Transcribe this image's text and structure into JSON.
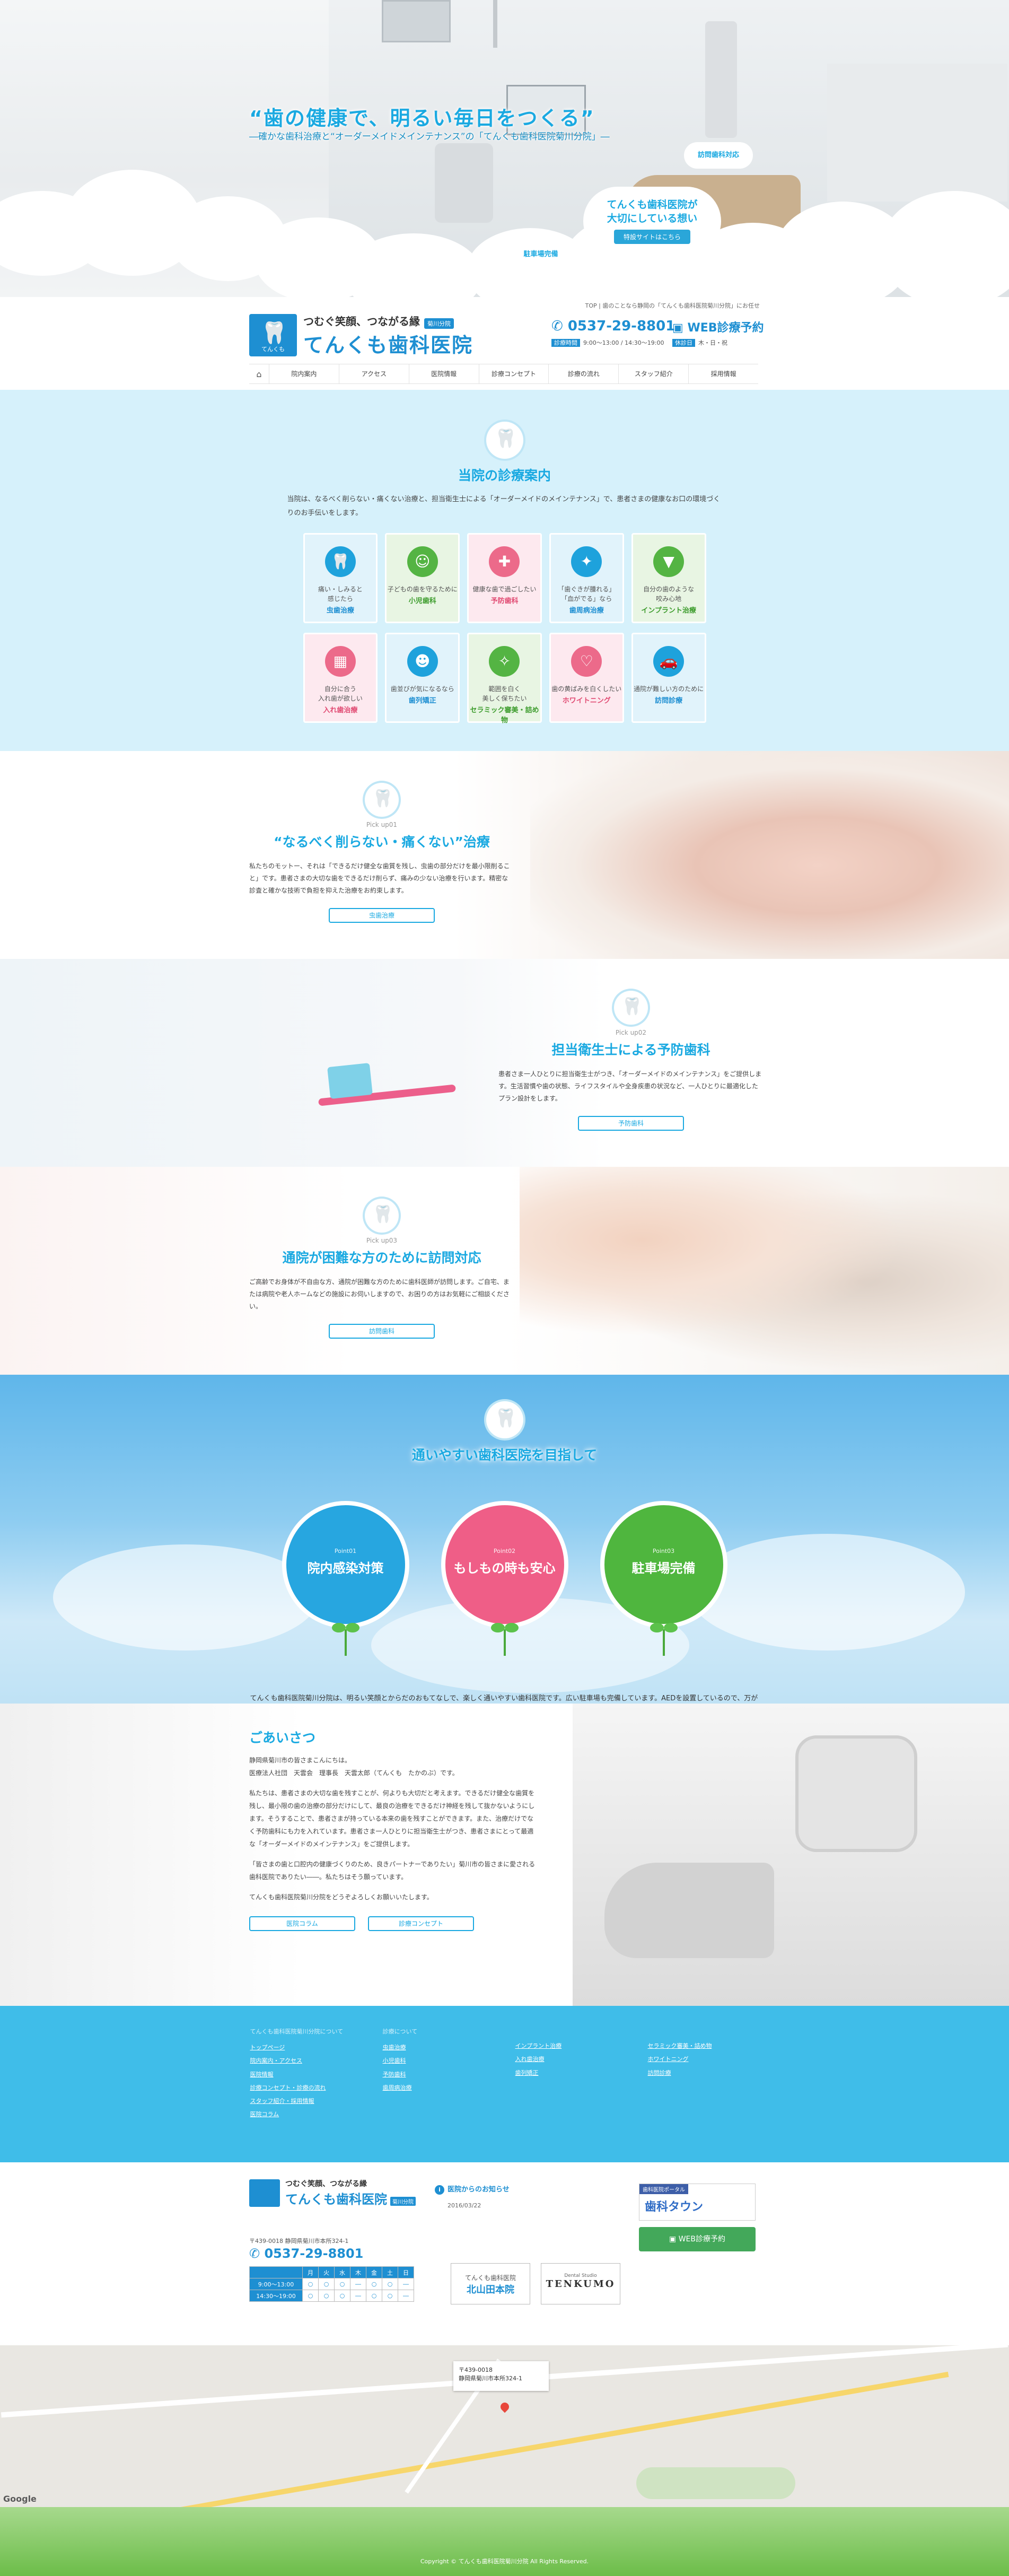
{
  "hero": {
    "catch": "“歯の健康で、明るい毎日をつくる”",
    "sub": "―確かな歯科治療と“オーダーメイドメインテナンス”の「てんくも歯科医院菊川分院」―",
    "badge_visit": "訪問歯科対応",
    "badge_parking": "駐車場完備",
    "feature_line1": "てんくも歯科医院が",
    "feature_line2": "大切にしている想い",
    "feature_btn": "特設サイトはこちら"
  },
  "header": {
    "breadcrumb": "TOP | 歯のことなら静岡の「てんくも歯科医院菊川分院」にお任せ",
    "tagline": "つむぐ笑顔、つながる縁",
    "branch": "菊川分院",
    "name": "てんくも歯科医院",
    "logo_mark": "てんくも",
    "tel": "0537-29-8801",
    "web": "WEB診療予約",
    "hours_label": "診療時間",
    "hours": "9:00～13:00 / 14:30～19:00",
    "closed_label": "休診日",
    "closed": "木・日・祝"
  },
  "nav": [
    "院内案内",
    "アクセス",
    "医院情報",
    "診療コンセプト",
    "診療の流れ",
    "スタッフ紹介",
    "採用情報"
  ],
  "menu": {
    "title": "当院の診療案内",
    "lead": "当院は、なるべく削らない・痛くない治療と、担当衛生士による「オーダーメイドのメインテナンス」で、患者さまの健康なお口の環境づくりのお手伝いをします。",
    "cards": [
      {
        "d1": "痛い・しみると",
        "d2": "感じたら",
        "n": "虫歯治療",
        "color": "blue",
        "icon": "tooth-icon",
        "sym": "🦷"
      },
      {
        "d1": "子どもの歯を守るために",
        "d2": "",
        "n": "小児歯科",
        "color": "green",
        "icon": "child-icon",
        "sym": "☺"
      },
      {
        "d1": "健康な歯で過ごしたい",
        "d2": "",
        "n": "予防歯科",
        "color": "pink",
        "icon": "shield-icon",
        "sym": "✚"
      },
      {
        "d1": "「歯ぐきが腫れる」",
        "d2": "「血がでる」なら",
        "n": "歯周病治療",
        "color": "blue",
        "icon": "gum-icon",
        "sym": "✦"
      },
      {
        "d1": "自分の歯のような",
        "d2": "咬み心地",
        "n": "インプラント治療",
        "color": "green",
        "icon": "implant-icon",
        "sym": "▼"
      },
      {
        "d1": "自分に合う",
        "d2": "入れ歯が欲しい",
        "n": "入れ歯治療",
        "color": "pink",
        "icon": "denture-icon",
        "sym": "▦"
      },
      {
        "d1": "歯並びが気になるなら",
        "d2": "",
        "n": "歯列矯正",
        "color": "blue",
        "icon": "braces-icon",
        "sym": "☻"
      },
      {
        "d1": "範囲を白く",
        "d2": "美しく保ちたい",
        "n": "セラミック審美・詰め物",
        "color": "green",
        "icon": "ceramic-icon",
        "sym": "✧"
      },
      {
        "d1": "歯の黄ばみを白くしたい",
        "d2": "",
        "n": "ホワイトニング",
        "color": "pink",
        "icon": "whitening-icon",
        "sym": "♡"
      },
      {
        "d1": "通院が難しい方のために",
        "d2": "",
        "n": "訪問診療",
        "color": "blue",
        "icon": "car-icon",
        "sym": "🚗"
      }
    ]
  },
  "pickups": [
    {
      "num": "Pick up01",
      "title": "“なるべく削らない・痛くない”治療",
      "desc": "私たちのモットー、それは「できるだけ健全な歯質を残し、虫歯の部分だけを最小限削ること」です。患者さまの大切な歯をできるだけ削らず、痛みの少ない治療を行います。精密な診査と確かな技術で負担を抑えた治療をお約束します。",
      "btn": "虫歯治療"
    },
    {
      "num": "Pick up02",
      "title": "担当衛生士による予防歯科",
      "desc": "患者さま一人ひとりに担当衛生士がつき、「オーダーメイドのメインテナンス」をご提供します。生活習慣や歯の状態、ライフスタイルや全身疾患の状況など、一人ひとりに最適化したプラン設計をします。",
      "btn": "予防歯科"
    },
    {
      "num": "Pick up03",
      "title": "通院が困難な方のために訪問対応",
      "desc": "ご高齢でお身体が不自由な方、通院が困難な方のために歯科医師が訪問します。ご自宅、または病院や老人ホームなどの施設にお伺いしますので、お困りの方はお気軽にご相談ください。",
      "btn": "訪問歯科"
    }
  ],
  "points": {
    "title": "通いやすい歯科医院を目指して",
    "items": [
      {
        "num": "Point01",
        "title": "院内感染対策",
        "color": "blue"
      },
      {
        "num": "Point02",
        "title": "もしもの時も安心",
        "color": "pink"
      },
      {
        "num": "Point03",
        "title": "駐車場完備",
        "color": "green"
      }
    ],
    "lead": "てんくも歯科医院菊川分院は、明るい笑顔とからだのおもてなしで、楽しく通いやすい歯科医院です。広い駐車場も完備しています。AEDを設置しているので、万が一にも安心。細菌の繁殖など、院内感染対策も万全です。"
  },
  "greeting": {
    "title": "ごあいさつ",
    "p1": "静岡県菊川市の皆さまこんにちは。",
    "p2": "医療法人社団　天雲会　理事長　天雲太郎（てんくも　たかのぶ）です。",
    "p3": "私たちは、患者さまの大切な歯を残すことが、何よりも大切だと考えます。できるだけ健全な歯質を残し、最小限の歯の治療の部分だけにして、最良の治療をできるだけ神経を残して抜かないようにします。そうすることで、患者さまが持っている本来の歯を残すことができます。また、治療だけでなく予防歯科にも力を入れています。患者さま一人ひとりに担当衛生士がつき、患者さまにとって最適な「オーダーメイドのメインテナンス」をご提供します。",
    "p4": "「皆さまの歯と口腔内の健康づくりのため、良きパートナーでありたい」菊川市の皆さまに愛される歯科医院でありたい――。私たちはそう願っています。",
    "p5": "てんくも歯科医院菊川分院をどうぞよろしくお願いいたします。",
    "btn1": "医院コラム",
    "btn2": "診療コンセプト"
  },
  "sitemap": {
    "col1_head": "てんくも歯科医院菊川分院について",
    "col1": [
      "トップページ",
      "院内案内・アクセス",
      "医院情報",
      "診療コンセプト・診療の流れ",
      "スタッフ紹介・採用情報",
      "医院コラム"
    ],
    "col2_head": "診療について",
    "col2": [
      "虫歯治療",
      "小児歯科",
      "予防歯科",
      "歯周病治療"
    ],
    "col3_head": "",
    "col3": [
      "インプラント治療",
      "入れ歯治療",
      "歯列矯正"
    ],
    "col4_head": "",
    "col4": [
      "セラミック審美・詰め物",
      "ホワイトニング",
      "訪問診療"
    ]
  },
  "footer": {
    "tagline": "つむぐ笑顔、つながる縁",
    "name": "てんくも歯科医院",
    "branch": "菊川分院",
    "address": "〒439-0018 静岡県菊川市本所324-1",
    "tel": "0537-29-8801",
    "news_title": "医院からのお知らせ",
    "news_date": "2016/03/22",
    "sched_days": [
      "月",
      "火",
      "水",
      "木",
      "金",
      "土",
      "日"
    ],
    "sched_rows": [
      {
        "time": "9:00～13:00",
        "marks": [
          "○",
          "○",
          "○",
          "―",
          "○",
          "○",
          "―"
        ]
      },
      {
        "time": "14:30～19:00",
        "marks": [
          "○",
          "○",
          "○",
          "―",
          "○",
          "○",
          "―"
        ]
      }
    ],
    "banner1_sub": "てんくも歯科医院",
    "banner1_main": "北山田本院",
    "banner2_sub": "Dental Studio",
    "banner2_main": "TENKUMO",
    "shika_label": "歯科医院ポータル",
    "shika_name": "歯科タウン",
    "web_btn": "WEB診療予約"
  },
  "map": {
    "info_zip": "〒439-0018",
    "info_addr": "静岡県菊川市本所324-1",
    "google": "Google"
  },
  "copyright": "Copyright © てんくも歯科医院菊川分院 All Rights Reserved."
}
